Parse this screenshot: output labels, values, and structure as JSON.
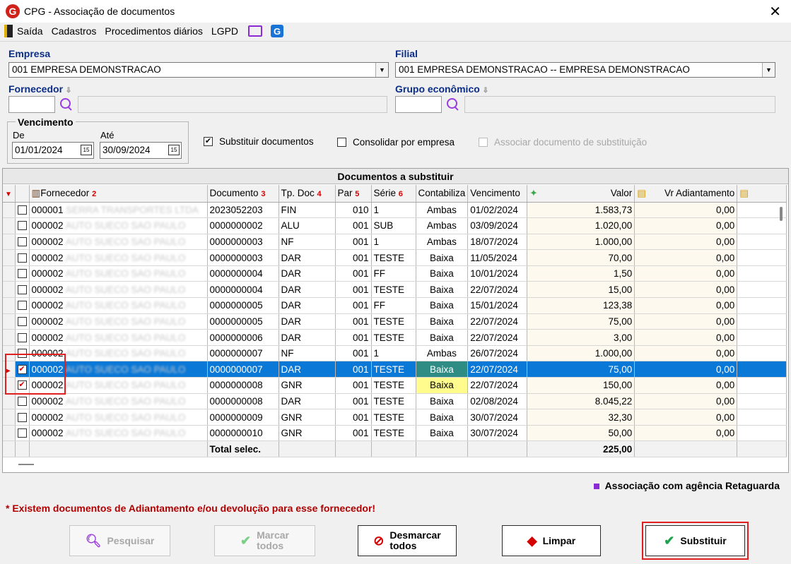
{
  "window": {
    "title": "CPG - Associação de documentos"
  },
  "menu": [
    "Saída",
    "Cadastros",
    "Procedimentos diários",
    "LGPD"
  ],
  "empresa": {
    "label": "Empresa",
    "value": "001 EMPRESA DEMONSTRACAO"
  },
  "filial": {
    "label": "Filial",
    "value": "001 EMPRESA DEMONSTRACAO -- EMPRESA DEMONSTRACAO"
  },
  "fornecedor": {
    "label": "Fornecedor"
  },
  "grupo": {
    "label": "Grupo econômico"
  },
  "vencimento": {
    "label": "Vencimento",
    "de_label": "De",
    "de": "01/01/2024",
    "ate_label": "Até",
    "ate": "30/09/2024"
  },
  "options": {
    "substituir": {
      "label": "Substituir documentos",
      "checked": "✔"
    },
    "consolidar": {
      "label": "Consolidar por empresa"
    },
    "associar": {
      "label": "Associar documento de substituição"
    }
  },
  "grid": {
    "title": "Documentos a substituir",
    "headers": [
      "Fornecedor",
      "Documento",
      "Tp. Doc",
      "Par",
      "Série",
      "Contabiliza",
      "Vencimento",
      "Valor",
      "Vr Adiantamento"
    ],
    "sort_marks": [
      "2",
      "3",
      "4",
      "5",
      "6"
    ],
    "rows": [
      {
        "check": "",
        "forn": "000001",
        "name": "SERRA TRANSPORTES LTDA",
        "doc": "2023052203",
        "tp": "FIN",
        "par": "010",
        "serie": "1",
        "cont": "Ambas",
        "venc": "01/02/2024",
        "valor": "1.583,73",
        "adi": "0,00"
      },
      {
        "check": "",
        "forn": "000002",
        "name": "AUTO SUECO SAO PAULO",
        "doc": "0000000002",
        "tp": "ALU",
        "par": "001",
        "serie": "SUB",
        "cont": "Ambas",
        "venc": "03/09/2024",
        "valor": "1.020,00",
        "adi": "0,00"
      },
      {
        "check": "",
        "forn": "000002",
        "name": "AUTO SUECO SAO PAULO",
        "doc": "0000000003",
        "tp": "NF",
        "par": "001",
        "serie": "1",
        "cont": "Ambas",
        "venc": "18/07/2024",
        "valor": "1.000,00",
        "adi": "0,00"
      },
      {
        "check": "",
        "forn": "000002",
        "name": "AUTO SUECO SAO PAULO",
        "doc": "0000000003",
        "tp": "DAR",
        "par": "001",
        "serie": "TESTE",
        "cont": "Baixa",
        "venc": "11/05/2024",
        "valor": "70,00",
        "adi": "0,00"
      },
      {
        "check": "",
        "forn": "000002",
        "name": "AUTO SUECO SAO PAULO",
        "doc": "0000000004",
        "tp": "DAR",
        "par": "001",
        "serie": "FF",
        "cont": "Baixa",
        "venc": "10/01/2024",
        "valor": "1,50",
        "adi": "0,00"
      },
      {
        "check": "",
        "forn": "000002",
        "name": "AUTO SUECO SAO PAULO",
        "doc": "0000000004",
        "tp": "DAR",
        "par": "001",
        "serie": "TESTE",
        "cont": "Baixa",
        "venc": "22/07/2024",
        "valor": "15,00",
        "adi": "0,00"
      },
      {
        "check": "",
        "forn": "000002",
        "name": "AUTO SUECO SAO PAULO",
        "doc": "0000000005",
        "tp": "DAR",
        "par": "001",
        "serie": "FF",
        "cont": "Baixa",
        "venc": "15/01/2024",
        "valor": "123,38",
        "adi": "0,00"
      },
      {
        "check": "",
        "forn": "000002",
        "name": "AUTO SUECO SAO PAULO",
        "doc": "0000000005",
        "tp": "DAR",
        "par": "001",
        "serie": "TESTE",
        "cont": "Baixa",
        "venc": "22/07/2024",
        "valor": "75,00",
        "adi": "0,00"
      },
      {
        "check": "",
        "forn": "000002",
        "name": "AUTO SUECO SAO PAULO",
        "doc": "0000000006",
        "tp": "DAR",
        "par": "001",
        "serie": "TESTE",
        "cont": "Baixa",
        "venc": "22/07/2024",
        "valor": "3,00",
        "adi": "0,00"
      },
      {
        "check": "",
        "forn": "000002",
        "name": "AUTO SUECO SAO PAULO",
        "doc": "0000000007",
        "tp": "NF",
        "par": "001",
        "serie": "1",
        "cont": "Ambas",
        "venc": "26/07/2024",
        "valor": "1.000,00",
        "adi": "0,00"
      },
      {
        "check": "✔",
        "forn": "000002",
        "name": "AUTO SUECO SAO PAULO",
        "doc": "0000000007",
        "tp": "DAR",
        "par": "001",
        "serie": "TESTE",
        "cont": "Baixa",
        "venc": "22/07/2024",
        "valor": "75,00",
        "adi": "0,00"
      },
      {
        "check": "✔",
        "forn": "000002",
        "name": "AUTO SUECO SAO PAULO",
        "doc": "0000000008",
        "tp": "GNR",
        "par": "001",
        "serie": "TESTE",
        "cont": "Baixa",
        "venc": "22/07/2024",
        "valor": "150,00",
        "adi": "0,00"
      },
      {
        "check": "",
        "forn": "000002",
        "name": "AUTO SUECO SAO PAULO",
        "doc": "0000000008",
        "tp": "DAR",
        "par": "001",
        "serie": "TESTE",
        "cont": "Baixa",
        "venc": "02/08/2024",
        "valor": "8.045,22",
        "adi": "0,00"
      },
      {
        "check": "",
        "forn": "000002",
        "name": "AUTO SUECO SAO PAULO",
        "doc": "0000000009",
        "tp": "GNR",
        "par": "001",
        "serie": "TESTE",
        "cont": "Baixa",
        "venc": "30/07/2024",
        "valor": "32,30",
        "adi": "0,00"
      },
      {
        "check": "",
        "forn": "000002",
        "name": "AUTO SUECO SAO PAULO",
        "doc": "0000000010",
        "tp": "GNR",
        "par": "001",
        "serie": "TESTE",
        "cont": "Baixa",
        "venc": "30/07/2024",
        "valor": "50,00",
        "adi": "0,00"
      }
    ],
    "total_label": "Total selec.",
    "total_value": "225,00"
  },
  "legend": "Associação com agência Retaguarda",
  "warning": "* Existem documentos de Adiantamento e/ou devolução para esse fornecedor!",
  "buttons": {
    "pesquisar": "Pesquisar",
    "marcar_1": "Marcar",
    "marcar_2": "todos",
    "desmarcar_1": "Desmarcar",
    "desmarcar_2": "todos",
    "limpar": "Limpar",
    "substituir": "Substituir"
  },
  "colors": {
    "selected_row": "#0a78d7",
    "highlight": "#fffb8c",
    "teal": "#2f8c84",
    "accent_red": "#e02020",
    "label_blue": "#0a2d88"
  }
}
